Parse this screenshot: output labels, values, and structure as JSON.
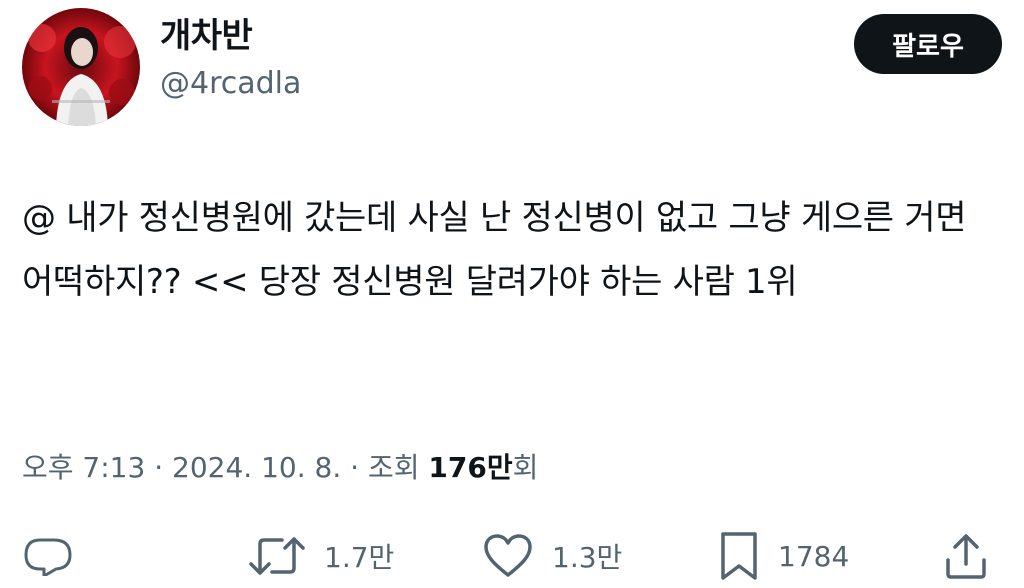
{
  "user": {
    "display_name": "개차반",
    "handle": "@4rcadla",
    "avatar_icon": "profile-avatar"
  },
  "follow_button": {
    "label": "팔로우"
  },
  "tweet": {
    "text": "@ 내가 정신병원에 갔는데 사실 난 정신병이 없고 그냥 게으른 거면 어떡하지?? << 당장 정신병원 달려가야 하는 사람 1위",
    "time": "오후 7:13",
    "separator": "·",
    "date": "2024. 10. 8.",
    "views_label": "조회",
    "views_count": "176만",
    "views_suffix": "회"
  },
  "actions": {
    "reply_icon": "reply-icon",
    "retweet_icon": "retweet-icon",
    "retweet_count": "1.7만",
    "like_icon": "heart-icon",
    "like_count": "1.3만",
    "bookmark_icon": "bookmark-icon",
    "bookmark_count": "1784",
    "share_icon": "share-icon"
  },
  "colors": {
    "text": "#0f1419",
    "secondary": "#536471",
    "button_bg": "#0f1419",
    "avatar_red": "#c8141e"
  }
}
